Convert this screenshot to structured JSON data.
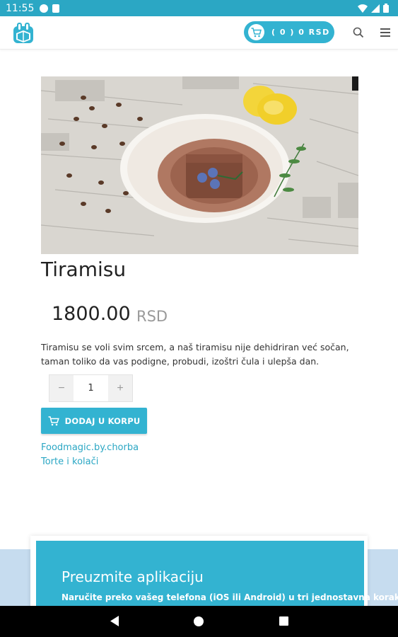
{
  "status_bar": {
    "time": "11:55",
    "battery": "",
    "icons": [
      "notification-icon",
      "sd-card-icon",
      "wifi-icon",
      "signal-icon",
      "battery-icon"
    ]
  },
  "header": {
    "logo": "logo-icon",
    "cart_label": "( 0 )  0 RSD",
    "search_icon": "search-icon",
    "menu_icon": "menu-icon"
  },
  "product": {
    "image_alt": "tiramisu-plate",
    "title": "Tiramisu",
    "price": "1800.00",
    "currency": "RSD",
    "description": "Tiramisu se voli svim srcem, a naš tiramisu nije dehidriran već sočan, taman toliko da vas podigne, probudi, izoštri čula i ulepša dan.",
    "quantity": {
      "minus": "−",
      "value": "1",
      "plus": "+"
    },
    "add_to_cart": "DODAJ U KORPU",
    "links": [
      "Foodmagic.by.chorba",
      "Torte i kolači"
    ]
  },
  "footer": {
    "title": "Preuzmite aplikaciju",
    "subtitle": "Naručite preko vašeg telefona (iOS ili Android) u tri jednostavna koraka:"
  },
  "colors": {
    "accent": "#33b3d1",
    "statusbar": "#2ba7c4",
    "footer_bg": "#c6dcef"
  }
}
